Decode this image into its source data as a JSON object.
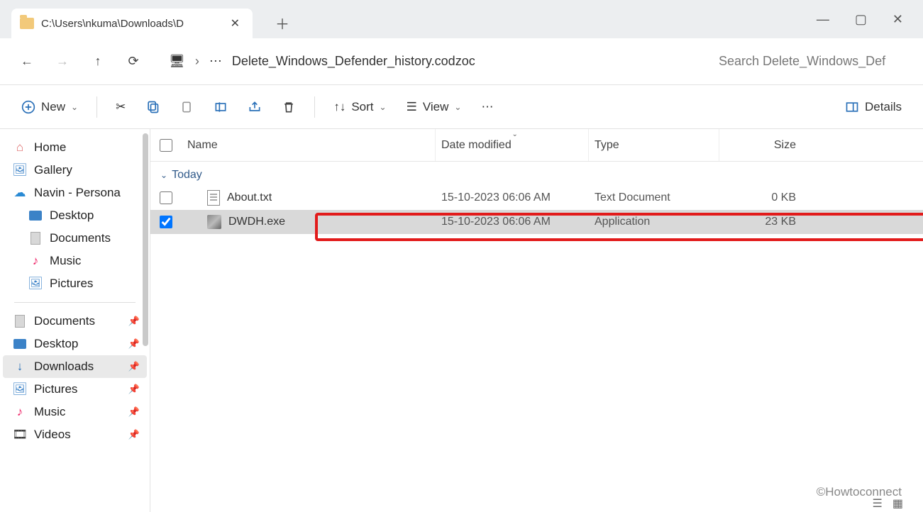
{
  "tab": {
    "title": "C:\\Users\\nkuma\\Downloads\\D"
  },
  "address": {
    "folder": "Delete_Windows_Defender_history.codzoc"
  },
  "search": {
    "placeholder": "Search Delete_Windows_Def"
  },
  "toolbar": {
    "new": "New",
    "sort": "Sort",
    "view": "View",
    "details": "Details"
  },
  "columns": {
    "name": "Name",
    "date": "Date modified",
    "type": "Type",
    "size": "Size"
  },
  "group": {
    "today": "Today"
  },
  "sidebar": {
    "home": "Home",
    "gallery": "Gallery",
    "onedrive": "Navin - Persona",
    "desktop": "Desktop",
    "documents": "Documents",
    "music": "Music",
    "pictures": "Pictures",
    "q_documents": "Documents",
    "q_desktop": "Desktop",
    "q_downloads": "Downloads",
    "q_pictures": "Pictures",
    "q_music": "Music",
    "q_videos": "Videos"
  },
  "files": [
    {
      "name": "About.txt",
      "date": "15-10-2023 06:06 AM",
      "type": "Text Document",
      "size": "0 KB",
      "selected": false,
      "icon": "txt"
    },
    {
      "name": "DWDH.exe",
      "date": "15-10-2023 06:06 AM",
      "type": "Application",
      "size": "23 KB",
      "selected": true,
      "icon": "exe"
    }
  ],
  "watermark": "©Howtoconnect"
}
